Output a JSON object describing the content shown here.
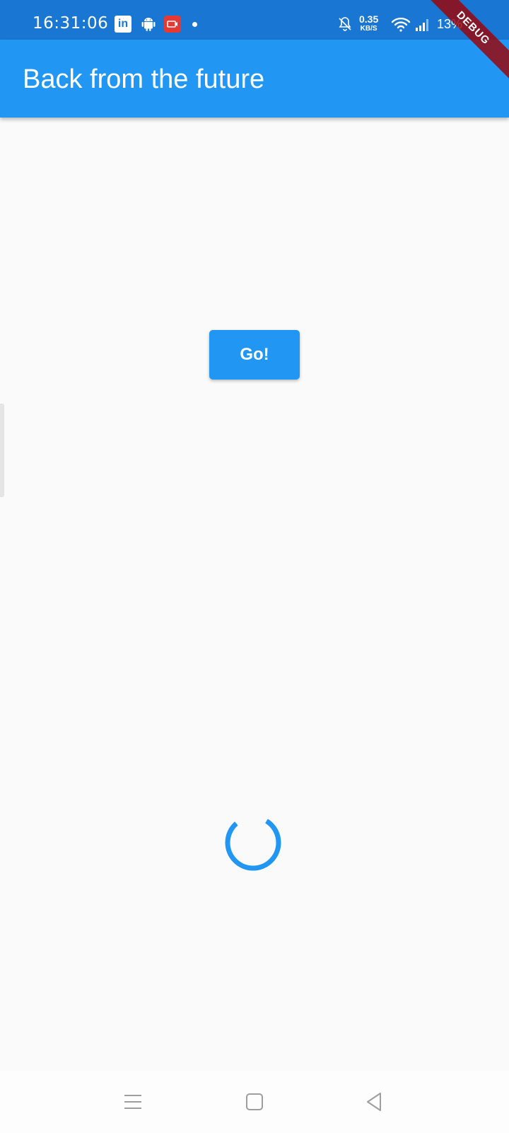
{
  "status_bar": {
    "time": "16:31:06",
    "network_speed_value": "0.35",
    "network_speed_unit": "KB/S",
    "battery": "13%",
    "icons": [
      "linkedin-icon",
      "android-icon",
      "screen-record-icon",
      "notification-dot-icon",
      "bell-off-icon",
      "wifi-icon",
      "signal-icon"
    ]
  },
  "app_bar": {
    "title": "Back from the future",
    "color": "#2196f3"
  },
  "debug_banner": {
    "label": "DEBUG"
  },
  "main": {
    "go_button_label": "Go!",
    "loading_indicator": "circular-progress-icon"
  },
  "nav_bar": {
    "buttons": [
      "menu-icon",
      "home-icon",
      "back-icon"
    ]
  },
  "colors": {
    "primary": "#2196f3",
    "status_bar": "#1976d2",
    "background": "#fafafa"
  }
}
